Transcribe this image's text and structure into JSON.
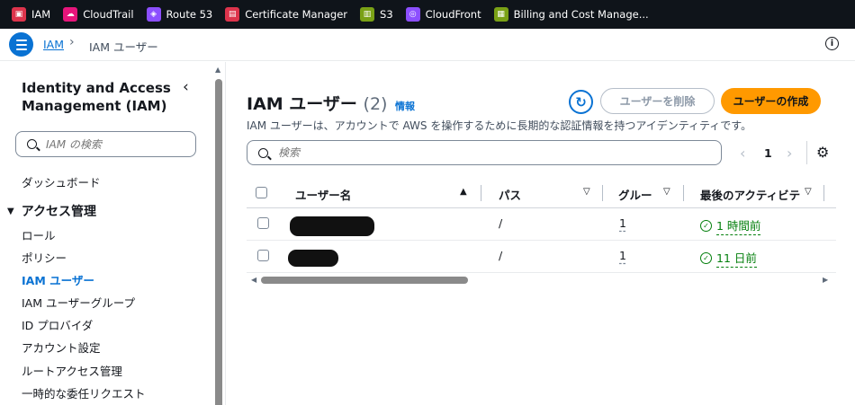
{
  "favorites": [
    {
      "label": "IAM",
      "color": "#dd344c",
      "glyph": "▣"
    },
    {
      "label": "CloudTrail",
      "color": "#e7157b",
      "glyph": "☁"
    },
    {
      "label": "Route 53",
      "color": "#8c4fff",
      "glyph": "◈"
    },
    {
      "label": "Certificate Manager",
      "color": "#dd344c",
      "glyph": "▤"
    },
    {
      "label": "S3",
      "color": "#7aa116",
      "glyph": "▥"
    },
    {
      "label": "CloudFront",
      "color": "#8c4fff",
      "glyph": "◎"
    },
    {
      "label": "Billing and Cost Manage...",
      "color": "#7aa116",
      "glyph": "▦"
    }
  ],
  "breadcrumb": {
    "root": "IAM",
    "current": "IAM ユーザー"
  },
  "sidebar": {
    "title": "Identity and Access Management (IAM)",
    "search_placeholder": "IAM の検索",
    "dashboard": "ダッシュボード",
    "section": "アクセス管理",
    "items": [
      "ロール",
      "ポリシー",
      "IAM ユーザー",
      "IAM ユーザーグループ",
      "ID プロバイダ",
      "アカウント設定",
      "ルートアクセス管理",
      "一時的な委任リクエスト"
    ]
  },
  "main": {
    "title": "IAM ユーザー",
    "count": "(2)",
    "info_link": "情報",
    "description": "IAM ユーザーは、アカウントで AWS を操作するために長期的な認証情報を持つアイデンティティです。",
    "delete_label": "ユーザーを削除",
    "create_label": "ユーザーの作成",
    "search_placeholder": "検索",
    "page": "1"
  },
  "table": {
    "columns": [
      "ユーザー名",
      "パス",
      "グルー",
      "最後のアクティビテ"
    ],
    "rows": [
      {
        "path": "/",
        "groups": "1",
        "activity": "1 時間前"
      },
      {
        "path": "/",
        "groups": "1",
        "activity": "11 日前"
      }
    ]
  }
}
